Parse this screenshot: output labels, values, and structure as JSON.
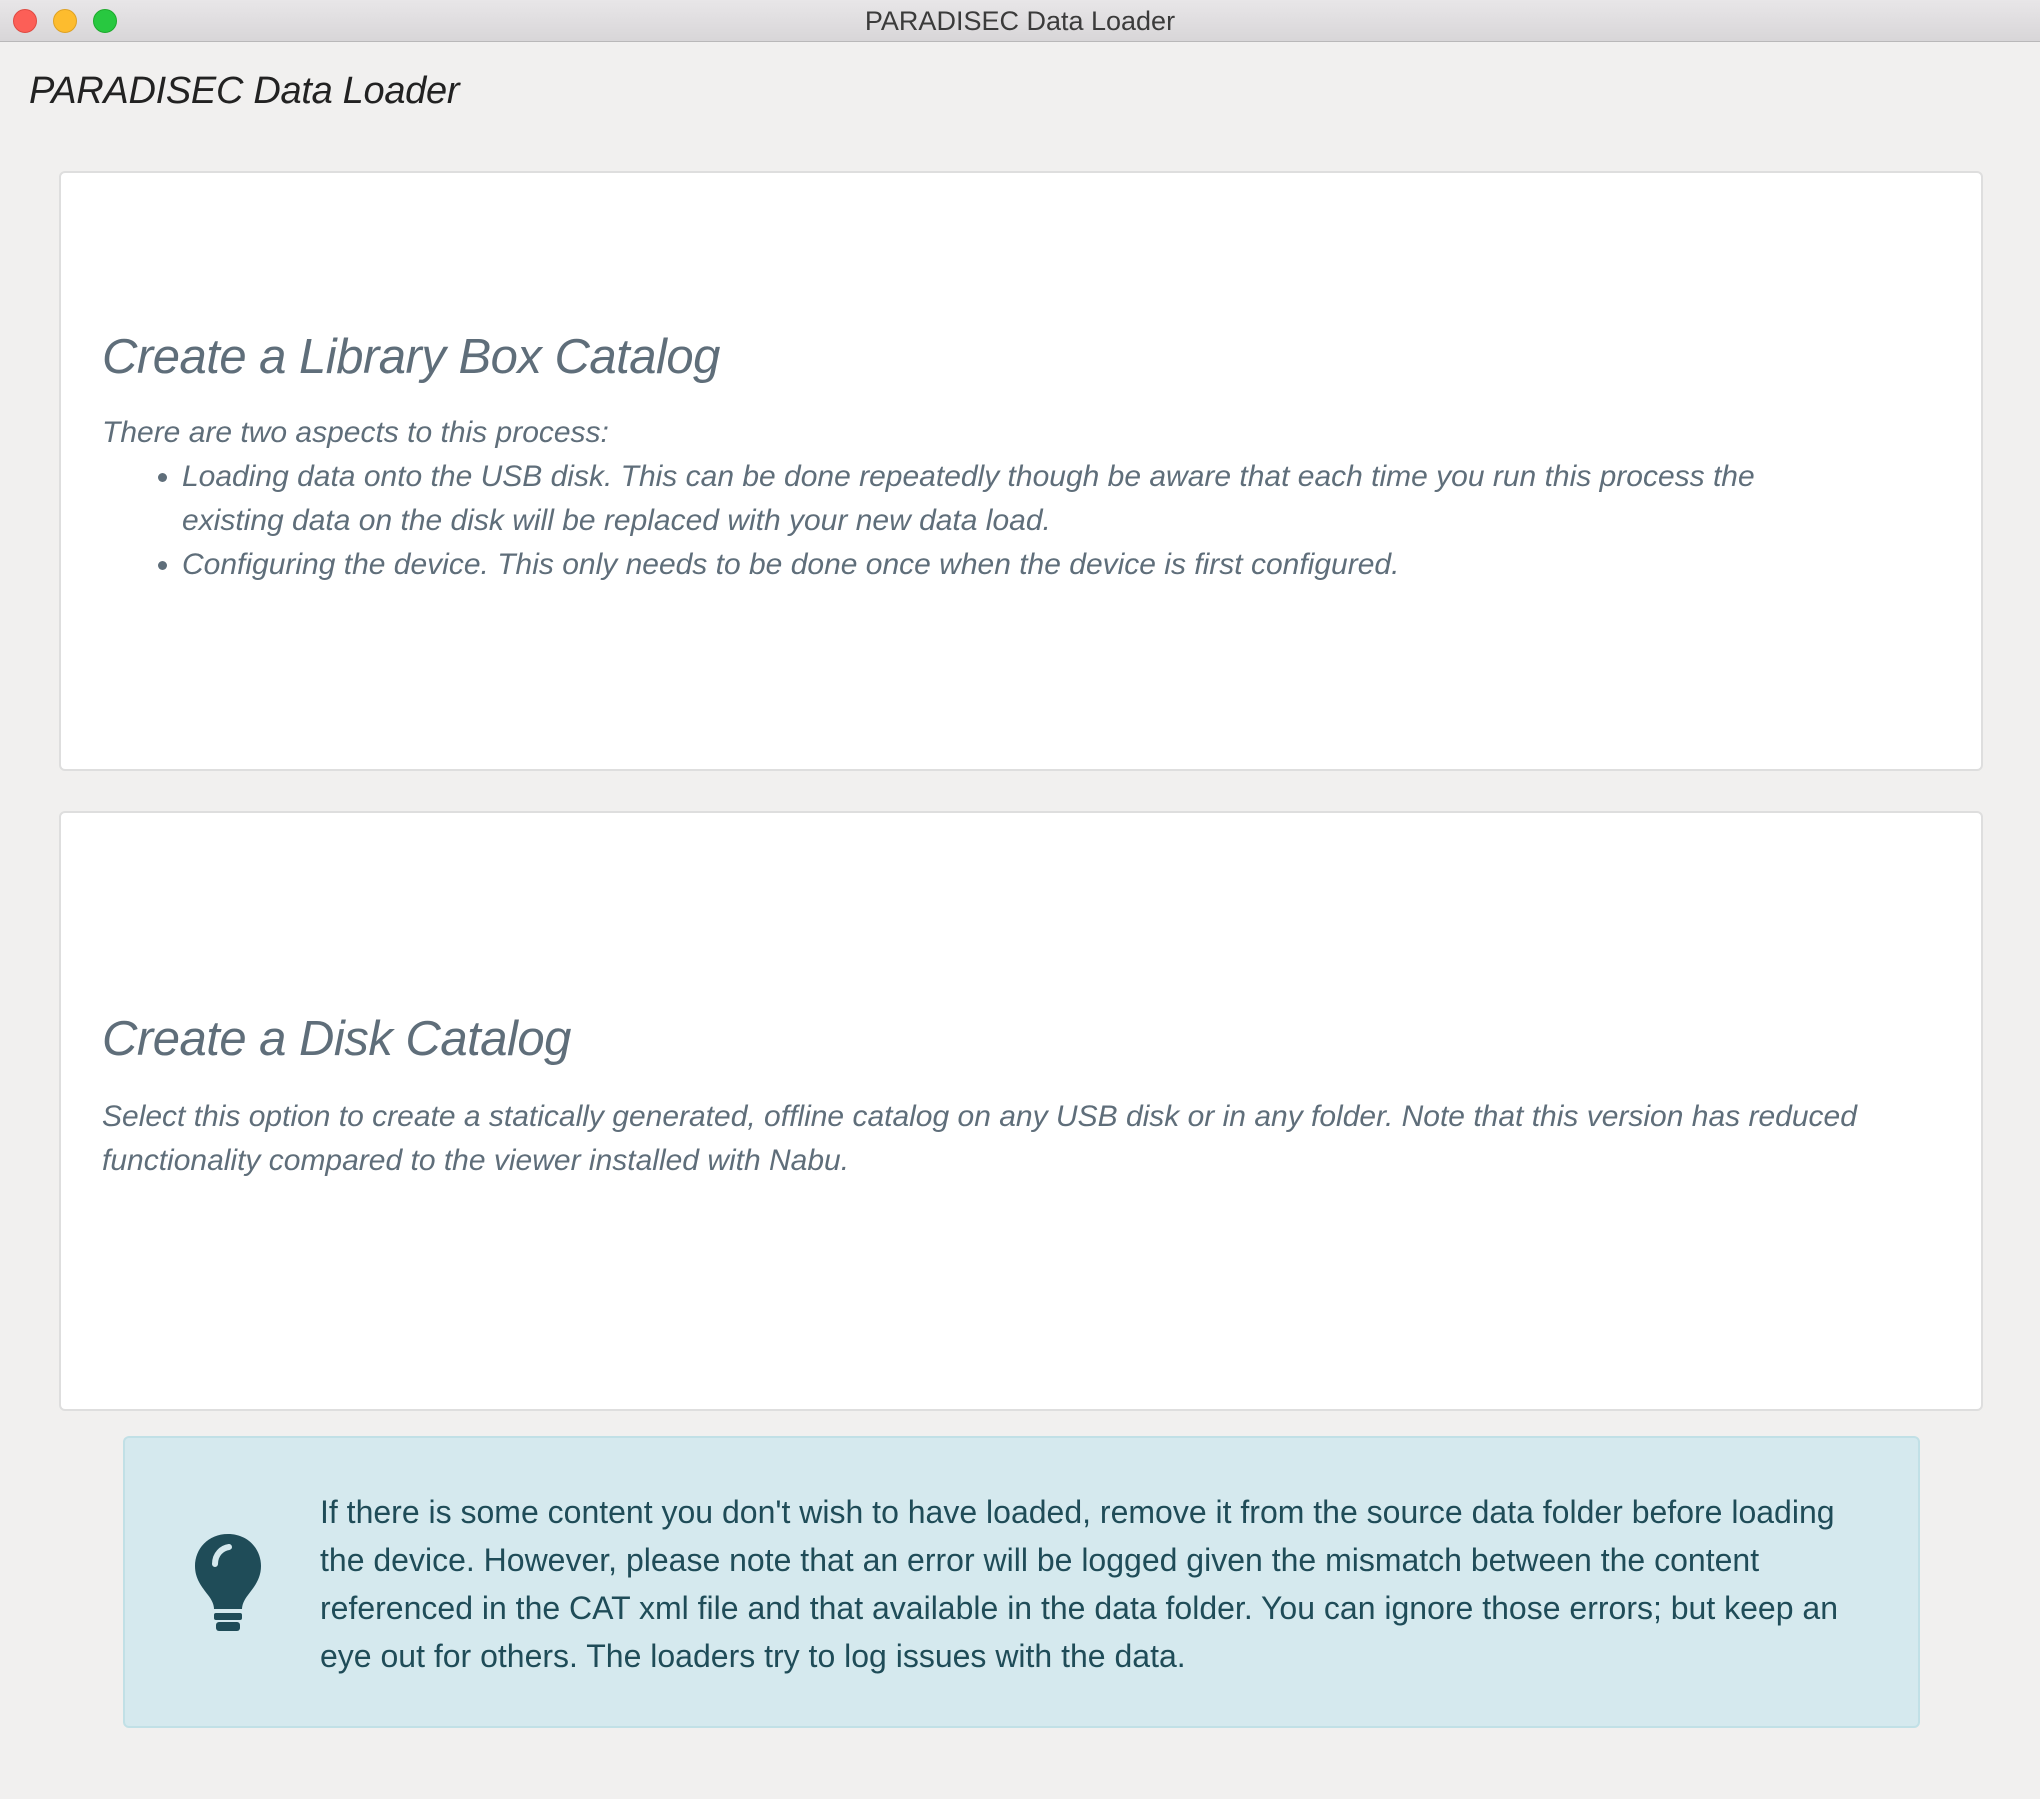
{
  "window": {
    "title": "PARADISEC Data Loader"
  },
  "app": {
    "heading": "PARADISEC Data Loader"
  },
  "library_box_card": {
    "title": "Create a Library Box Catalog",
    "intro": "There are two aspects to this process:",
    "items": [
      "Loading data onto the USB disk. This can be done repeatedly though be aware that each time you run this process the existing data on the disk will be replaced with your new data load.",
      "Configuring the device. This only needs to be done once when the device is first configured."
    ]
  },
  "disk_card": {
    "title": "Create a Disk Catalog",
    "description": "Select this option to create a statically generated, offline catalog on any USB disk or in any folder. Note that this version has reduced functionality compared to the viewer installed with Nabu."
  },
  "info": {
    "icon": "lightbulb-icon",
    "text": "If there is some content you don't wish to have loaded, remove it from the source data folder before loading the device. However, please note that an error will be logged given the mismatch between the content referenced in the CAT xml file and that available in the data folder. You can ignore those errors; but keep an eye out for others. The loaders try to log issues with the data."
  },
  "colors": {
    "card_text": "#5f6e7a",
    "info_background": "#d5e9ee",
    "info_text": "#1f4c58",
    "icon": "#1f4c58"
  }
}
